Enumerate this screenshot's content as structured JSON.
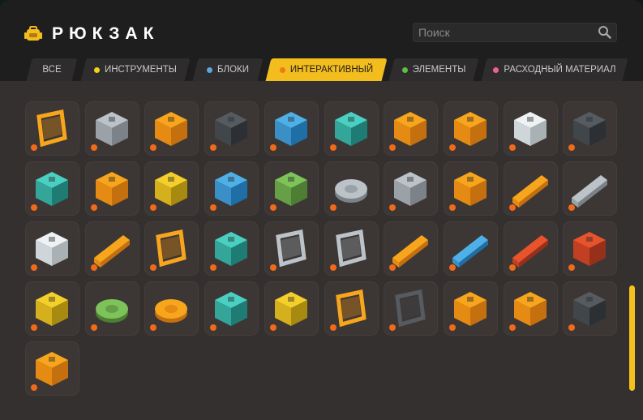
{
  "header": {
    "title": "РЮКЗАК",
    "icon": "backpack-icon",
    "title_color": "#ffffff",
    "background_color": "#1f1e1f"
  },
  "search": {
    "placeholder": "Поиск",
    "value": "",
    "icon": "search-icon"
  },
  "tabs": [
    {
      "label": "ВСЕ",
      "dot_color": null,
      "active": false
    },
    {
      "label": "ИНСТРУМЕНТЫ",
      "dot_color": "#f0d21a",
      "active": false
    },
    {
      "label": "БЛОКИ",
      "dot_color": "#58a8e0",
      "active": false
    },
    {
      "label": "ИНТЕРАКТИВНЫЙ",
      "dot_color": "#f07a18",
      "active": true
    },
    {
      "label": "ЭЛЕМЕНТЫ",
      "dot_color": "#5cbf4a",
      "active": false
    },
    {
      "label": "РАСХОДНЫЙ МАТЕРИАЛ",
      "dot_color": "#f06098",
      "active": false
    }
  ],
  "colors": {
    "accent": "#f4bd1e",
    "panel": "#33302f",
    "cell": "#3c3735",
    "rarity_interactive": "#f06a1a"
  },
  "inventory": {
    "category": "interactive",
    "rows": [
      [
        "control-panel-icon",
        "speaker-block-icon",
        "orange-speaker-icon",
        "dark-speaker-icon",
        "blue-speaker-icon",
        "teal-speaker-icon",
        "cross-pad-icon",
        "star-pad-icon",
        "white-star-pad-icon",
        "cross-pad-dark-icon"
      ],
      [
        "target-spawn-icon",
        "battery-box-icon",
        "vending-machine-icon",
        "blue-crate-icon",
        "green-crate-icon",
        "round-saw-icon",
        "spiked-dome-icon",
        "barrel-stack-icon",
        "orange-pipe-icon",
        "grey-pipe-icon"
      ],
      [
        "white-tile-icon",
        "sword-plank-icon",
        "easel-frame-icon",
        "console-stand-icon",
        "glass-panel-icon",
        "glass-wall-icon",
        "striped-rail-icon",
        "blue-rail-icon",
        "red-rail-icon",
        "horseshoe-magnet-icon"
      ],
      [
        "arcade-cabinet-icon",
        "green-bowl-icon",
        "orange-pot-icon",
        "neon-spiral-icon",
        "yellow-capsule-icon",
        "bracket-frame-icon",
        "dark-frame-icon",
        "treasure-chest-icon",
        "mech-crate-icon",
        "metal-cage-icon"
      ],
      [
        "robot-crate-icon"
      ]
    ]
  },
  "scrollbar": {
    "position": 0.6,
    "thumb_color": "#f5c21c"
  }
}
